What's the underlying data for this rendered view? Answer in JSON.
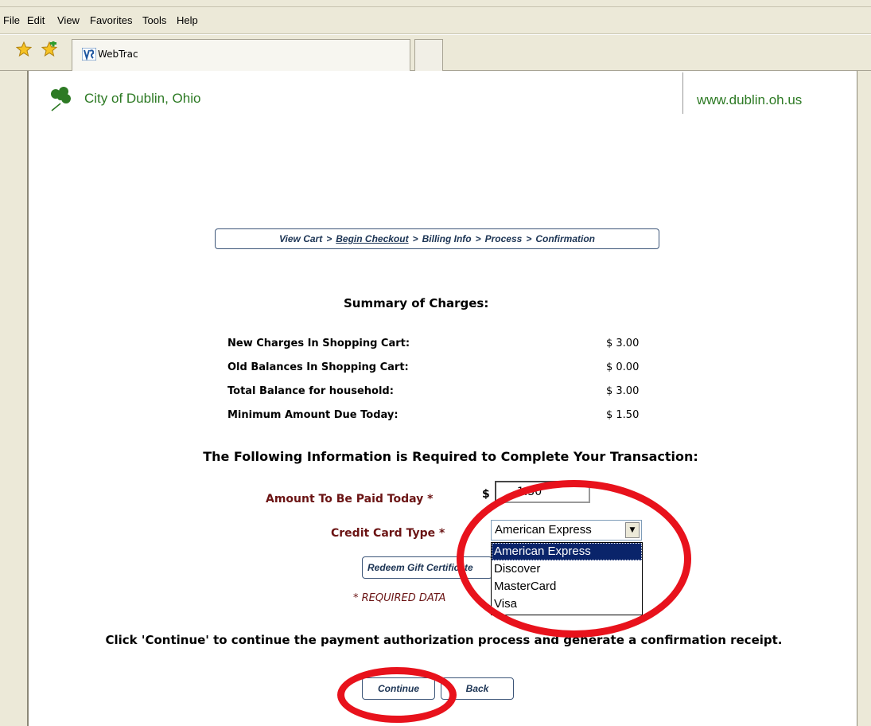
{
  "browser": {
    "menu": [
      "File",
      "Edit",
      "View",
      "Favorites",
      "Tools",
      "Help"
    ],
    "tab_title": "WebTrac"
  },
  "header": {
    "site_name": "City of Dublin, Ohio",
    "site_url": "www.dublin.oh.us"
  },
  "breadcrumb": {
    "view_cart": "View Cart",
    "begin_checkout": "Begin Checkout",
    "billing_info": "Billing Info",
    "process": "Process",
    "confirmation": "Confirmation",
    "separator": ">"
  },
  "summary": {
    "title": "Summary of Charges:",
    "rows": [
      {
        "label": "New Charges In Shopping Cart:",
        "value": "$ 3.00"
      },
      {
        "label": "Old Balances In Shopping Cart:",
        "value": "$ 0.00"
      },
      {
        "label": "Total Balance for household:",
        "value": "$ 3.00"
      },
      {
        "label": "Minimum Amount Due Today:",
        "value": "$ 1.50"
      }
    ]
  },
  "form": {
    "required_title": "The Following Information is Required to Complete Your Transaction:",
    "amount_label": "Amount To Be Paid Today *",
    "currency": "$",
    "amount_value": "1.50",
    "card_type_label": "Credit Card Type *",
    "card_type_selected": "American Express",
    "card_options": [
      "American Express",
      "Discover",
      "MasterCard",
      "Visa"
    ],
    "gift_button": "Redeem Gift Certificate",
    "required_note": "* REQUIRED DATA"
  },
  "footer": {
    "continue_message": "Click 'Continue' to continue the payment authorization process and generate a confirmation receipt.",
    "continue_button": "Continue",
    "back_button": "Back"
  },
  "colors": {
    "brand_green": "#2d7a24",
    "label_maroon": "#6b1414",
    "annotation_red": "#e8121c",
    "selection_blue": "#0a246a"
  }
}
